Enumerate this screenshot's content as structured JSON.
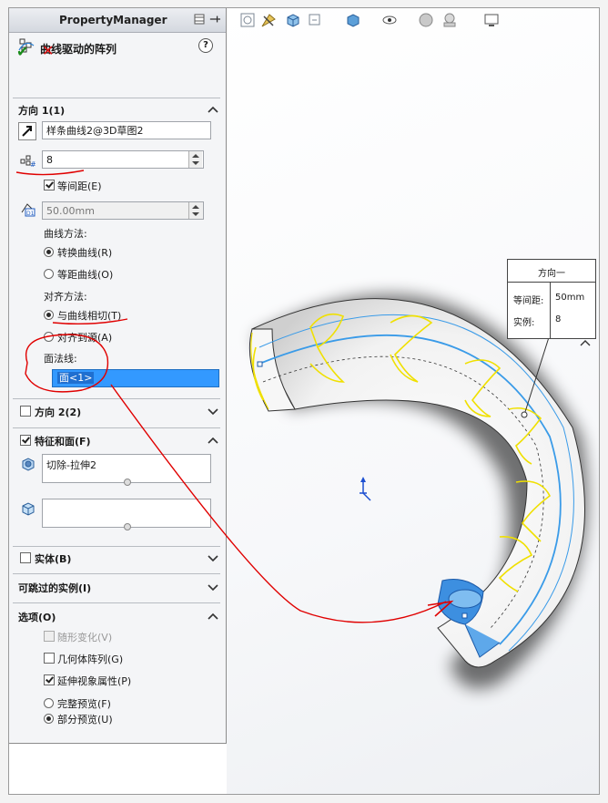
{
  "property_manager": {
    "header_title": "PropertyManager",
    "feature_title": "曲线驱动的阵列",
    "help_label": "?"
  },
  "direction1": {
    "title": "方向 1(1)",
    "curve_value": "样条曲线2@3D草图2",
    "instances_value": "8",
    "equal_spacing_label": "等间距(E)",
    "equal_spacing_checked": true,
    "spacing_value": "50.00mm",
    "curve_method_label": "曲线方法:",
    "curve_method_options": [
      "转换曲线(R)",
      "等距曲线(O)"
    ],
    "curve_method_selected": 0,
    "align_method_label": "对齐方法:",
    "align_method_options": [
      "与曲线相切(T)",
      "对齐到源(A)"
    ],
    "align_method_selected": 0,
    "face_normal_label": "面法线:",
    "face_normal_value": "面<1>"
  },
  "direction2": {
    "title": "方向 2(2)",
    "checked": false
  },
  "features_faces": {
    "title": "特征和面(F)",
    "checked": true,
    "features_list": [
      "切除-拉伸2"
    ],
    "faces_list": []
  },
  "bodies": {
    "title": "实体(B)",
    "checked": false
  },
  "skip_instances": {
    "title": "可跳过的实例(I)"
  },
  "options": {
    "title": "选项(O)",
    "checkboxes": [
      {
        "label": "随形变化(V)",
        "checked": false,
        "disabled": true
      },
      {
        "label": "几何体阵列(G)",
        "checked": false,
        "disabled": false
      },
      {
        "label": "延伸视象属性(P)",
        "checked": true,
        "disabled": false
      }
    ],
    "preview_options": [
      "完整预览(F)",
      "部分预览(U)"
    ],
    "preview_selected": 1
  },
  "callout": {
    "title": "方向一",
    "spacing_label": "等间距:",
    "spacing_value": "50mm",
    "instances_label": "实例:",
    "instances_value": "8"
  },
  "colors": {
    "accent": "#3399ff",
    "annotation_red": "#e00000",
    "pattern_yellow": "#f0e000",
    "curve_blue": "#3a9be8"
  }
}
